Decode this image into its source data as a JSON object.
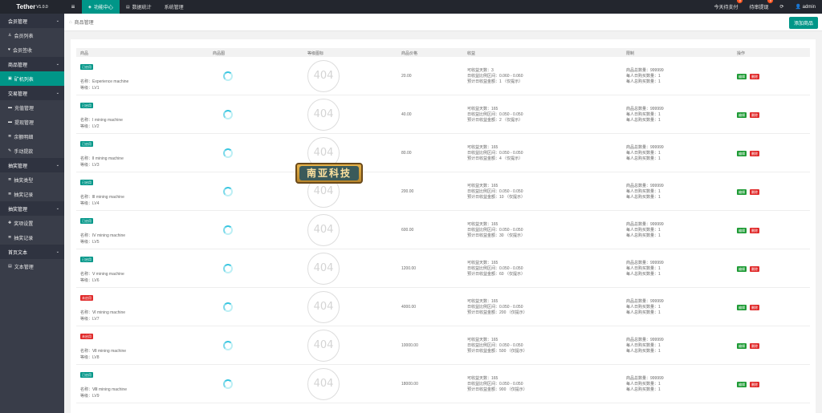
{
  "app": {
    "title": "Tether",
    "version": "V1.0.0"
  },
  "topnav": [
    {
      "icon": "layers-icon",
      "label": "功能中心",
      "active": true
    },
    {
      "icon": "chart-icon",
      "label": "数据统计",
      "active": false
    },
    {
      "icon": "",
      "label": "系统管理",
      "active": false
    }
  ],
  "topright": {
    "pay": "今天待支付",
    "pay_badge": "0",
    "review": "待审提现",
    "review_badge": "0",
    "user": "admin"
  },
  "sidebar": [
    {
      "type": "group",
      "label": "会员管理"
    },
    {
      "type": "item",
      "icon": "user-icon",
      "label": "会员列表"
    },
    {
      "type": "item",
      "icon": "heart-icon",
      "label": "会员签收"
    },
    {
      "type": "group",
      "label": "商品管理"
    },
    {
      "type": "item",
      "icon": "image-icon",
      "label": "矿机列表",
      "active": true
    },
    {
      "type": "group",
      "label": "交易管理"
    },
    {
      "type": "item",
      "icon": "card-icon",
      "label": "充值管理"
    },
    {
      "type": "item",
      "icon": "card-icon",
      "label": "提现管理"
    },
    {
      "type": "item",
      "icon": "list-icon",
      "label": "余额明细"
    },
    {
      "type": "item",
      "icon": "edit-icon",
      "label": "手动提款"
    },
    {
      "type": "group",
      "label": "抽奖管理"
    },
    {
      "type": "item",
      "icon": "list-icon",
      "label": "抽奖类型"
    },
    {
      "type": "item",
      "icon": "list-icon",
      "label": "抽奖记录"
    },
    {
      "type": "group",
      "label": "抽奖管理"
    },
    {
      "type": "item",
      "icon": "gift-icon",
      "label": "奖项设置"
    },
    {
      "type": "item",
      "icon": "list-icon",
      "label": "抽奖记录"
    },
    {
      "type": "group",
      "label": "首页文本"
    },
    {
      "type": "item",
      "icon": "doc-icon",
      "label": "文本管理"
    }
  ],
  "breadcrumb": "商品管理",
  "add_button": "添加商品",
  "table": {
    "headers": [
      "商品",
      "商品图",
      "等级图标",
      "商品价格",
      "收益",
      "限制",
      "操作"
    ],
    "edit_label": "编辑",
    "delete_label": "删除",
    "img_text": "404",
    "rows": [
      {
        "status": "已启用",
        "status_on": true,
        "name": "名称：Experience machine",
        "level": "等级：LV1",
        "price": "20.00",
        "income": [
          "可收益天数：3",
          "日收益比例区间：0.060 - 0.060",
          "预计日收益金额：1 （仅提示）"
        ],
        "limit": [
          "商品总数量：999999",
          "每人日购买数量：1",
          "每人总购买数量：1"
        ]
      },
      {
        "status": "已启用",
        "status_on": true,
        "name": "名称：Ⅰ mining machine",
        "level": "等级：LV2",
        "price": "40.00",
        "income": [
          "可收益天数：165",
          "日收益比例区间：0.050 - 0.050",
          "预计日收益金额：2 （仅提示）"
        ],
        "limit": [
          "商品总数量：999999",
          "每人日购买数量：1",
          "每人总购买数量：1"
        ]
      },
      {
        "status": "已启用",
        "status_on": true,
        "name": "名称：Ⅱ mining machine",
        "level": "等级：LV3",
        "price": "80.00",
        "income": [
          "可收益天数：165",
          "日收益比例区间：0.050 - 0.050",
          "预计日收益金额：4 （仅提示）"
        ],
        "limit": [
          "商品总数量：999999",
          "每人日购买数量：1",
          "每人总购买数量：1"
        ]
      },
      {
        "status": "已启用",
        "status_on": true,
        "name": "名称：Ⅲ mining machine",
        "level": "等级：LV4",
        "price": "200.00",
        "income": [
          "可收益天数：165",
          "日收益比例区间：0.050 - 0.050",
          "预计日收益金额：10 （仅提示）"
        ],
        "limit": [
          "商品总数量：999999",
          "每人日购买数量：1",
          "每人总购买数量：1"
        ]
      },
      {
        "status": "已启用",
        "status_on": true,
        "name": "名称：Ⅳ mining machine",
        "level": "等级：LV5",
        "price": "600.00",
        "income": [
          "可收益天数：165",
          "日收益比例区间：0.050 - 0.050",
          "预计日收益金额：30 （仅提示）"
        ],
        "limit": [
          "商品总数量：999999",
          "每人日购买数量：1",
          "每人总购买数量：1"
        ]
      },
      {
        "status": "已启用",
        "status_on": true,
        "name": "名称：Ⅴ mining machine",
        "level": "等级：LV6",
        "price": "1200.00",
        "income": [
          "可收益天数：165",
          "日收益比例区间：0.050 - 0.050",
          "预计日收益金额：60 （仅提示）"
        ],
        "limit": [
          "商品总数量：999999",
          "每人日购买数量：1",
          "每人总购买数量：1"
        ]
      },
      {
        "status": "未启用",
        "status_on": false,
        "name": "名称：Ⅵ mining machine",
        "level": "等级：LV7",
        "price": "4000.00",
        "income": [
          "可收益天数：165",
          "日收益比例区间：0.050 - 0.050",
          "预计日收益金额：200 （仅提示）"
        ],
        "limit": [
          "商品总数量：999999",
          "每人日购买数量：1",
          "每人总购买数量：1"
        ]
      },
      {
        "status": "未启用",
        "status_on": false,
        "name": "名称：Ⅶ mining machine",
        "level": "等级：LV8",
        "price": "10000.00",
        "income": [
          "可收益天数：165",
          "日收益比例区间：0.050 - 0.050",
          "预计日收益金额：500 （仅提示）"
        ],
        "limit": [
          "商品总数量：999999",
          "每人日购买数量：1",
          "每人总购买数量：1"
        ]
      },
      {
        "status": "已启用",
        "status_on": true,
        "name": "名称：Ⅷ mining machine",
        "level": "等级：LV9",
        "price": "18000.00",
        "income": [
          "可收益天数：165",
          "日收益比例区间：0.050 - 0.050",
          "预计日收益金额：900 （仅提示）"
        ],
        "limit": [
          "商品总数量：999999",
          "每人日购买数量：1",
          "每人总购买数量：1"
        ]
      }
    ]
  },
  "watermark": "南亚科技"
}
